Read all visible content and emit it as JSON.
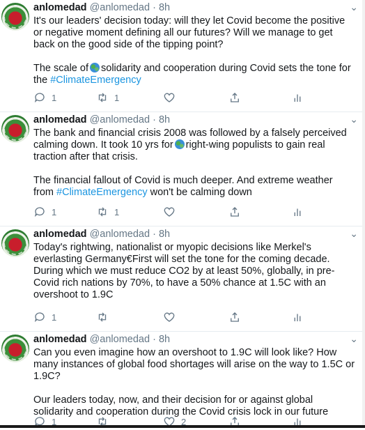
{
  "tweets": [
    {
      "name": "anlomedad",
      "handle": "@anlomedad",
      "time": "8h",
      "para1": "It's our leaders' decision today: will they let Covid become the positive or negative moment defining all our futures? Will we manage to get back on the good side of the tipping point?",
      "para2_before": "The scale of",
      "para2_after": "solidarity and cooperation during Covid sets the tone for the ",
      "hashtag": "#ClimateEmergency",
      "replies": "1",
      "retweets": "1",
      "likes": ""
    },
    {
      "name": "anlomedad",
      "handle": "@anlomedad",
      "time": "8h",
      "para1_before": "The bank and financial crisis 2008 was followed by a falsely perceived calming down. It took 10 yrs for",
      "para1_after": "right-wing populists to gain real traction after that crisis.",
      "para2_before": "The financial fallout of Covid is much deeper. And extreme weather from ",
      "hashtag": "#ClimateEmergency",
      "para2_after": " won't be calming down",
      "replies": "1",
      "retweets": "1",
      "likes": ""
    },
    {
      "name": "anlomedad",
      "handle": "@anlomedad",
      "time": "8h",
      "para1": "Today's rightwing, nationalist or myopic decisions like Merkel's everlasting Germany€First will set the tone for the coming decade. During which we must reduce CO2 by at least 50%, globally, in pre-Covid rich nations by 70%, to have a 50% chance at 1.5C with an overshoot to 1.9C",
      "replies": "1",
      "retweets": "",
      "likes": ""
    },
    {
      "name": "anlomedad",
      "handle": "@anlomedad",
      "time": "8h",
      "para1": "Can you even imagine how an overshoot to 1.9C will look like? How many instances of global food shortages will arise on the way to 1.5C or 1.9C?",
      "para2": "Our leaders today, now, and their decision for or against global solidarity and cooperation during the Covid crisis lock in our future",
      "replies": "1",
      "retweets": "",
      "likes": "2"
    }
  ],
  "icons": {
    "reply": "reply-icon",
    "retweet": "retweet-icon",
    "like": "heart-icon",
    "share": "share-icon",
    "stats": "analytics-icon",
    "more": "chevron-down-icon"
  },
  "colors": {
    "link": "#1b95e0",
    "muted": "#657786",
    "text": "#14171a"
  }
}
